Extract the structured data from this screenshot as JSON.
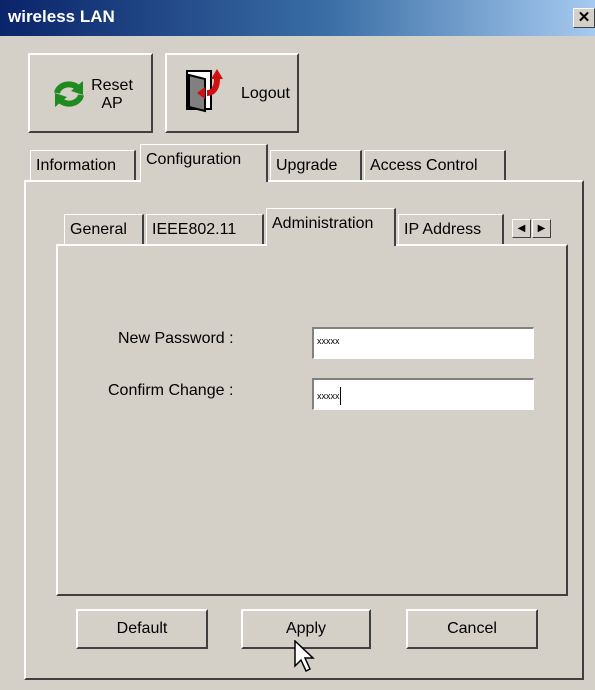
{
  "window": {
    "title": "wireless LAN",
    "close_glyph": "✕"
  },
  "toolbar": {
    "reset": {
      "line1": "Reset",
      "line2": "AP",
      "icon": "refresh-arrows-icon"
    },
    "logout": {
      "label": "Logout",
      "icon": "door-exit-icon"
    }
  },
  "main_tabs": [
    {
      "label": "Information"
    },
    {
      "label": "Configuration",
      "active": true
    },
    {
      "label": "Upgrade"
    },
    {
      "label": "Access Control"
    }
  ],
  "sub_tabs": [
    {
      "label": "General"
    },
    {
      "label": "IEEE802.11"
    },
    {
      "label": "Administration",
      "active": true
    },
    {
      "label": "IP Address"
    }
  ],
  "form": {
    "new_password": {
      "label": "New Password :",
      "value": "xxxxx"
    },
    "confirm_change": {
      "label": "Confirm Change :",
      "value": "xxxxx"
    }
  },
  "buttons": {
    "default": "Default",
    "apply": "Apply",
    "cancel": "Cancel"
  },
  "colors": {
    "face": "#d4d0c8",
    "titlebar": "#0a246a",
    "titlebar_end": "#a6caf0"
  }
}
